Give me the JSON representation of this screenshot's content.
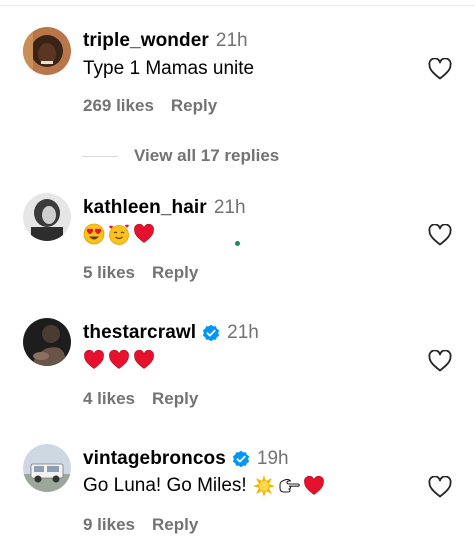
{
  "comments": [
    {
      "username": "triple_wonder",
      "time": "21h",
      "text": "Type 1 Mamas unite",
      "likes": "269 likes",
      "reply": "Reply",
      "verified": false
    },
    {
      "username": "kathleen_hair",
      "time": "21h",
      "text": "",
      "emojis": [
        "heart-eyes-emoji",
        "smiling-hearts-emoji",
        "red-heart-emoji"
      ],
      "likes": "5 likes",
      "reply": "Reply",
      "verified": false
    },
    {
      "username": "thestarcrawl",
      "time": "21h",
      "text": "",
      "emojis": [
        "red-heart-emoji",
        "red-heart-emoji",
        "red-heart-emoji"
      ],
      "likes": "4 likes",
      "reply": "Reply",
      "verified": true
    },
    {
      "username": "vintagebroncos",
      "time": "19h",
      "text": "Go Luna! Go Miles!",
      "emojis": [
        "sun-emoji",
        "pointing-hand-emoji",
        "red-heart-emoji"
      ],
      "likes": "9 likes",
      "reply": "Reply",
      "verified": true
    }
  ],
  "view_replies": "View all 17 replies",
  "colors": {
    "secondary_text": "#737373",
    "verified_blue": "#0095f6",
    "heart_red": "#ff3040"
  }
}
